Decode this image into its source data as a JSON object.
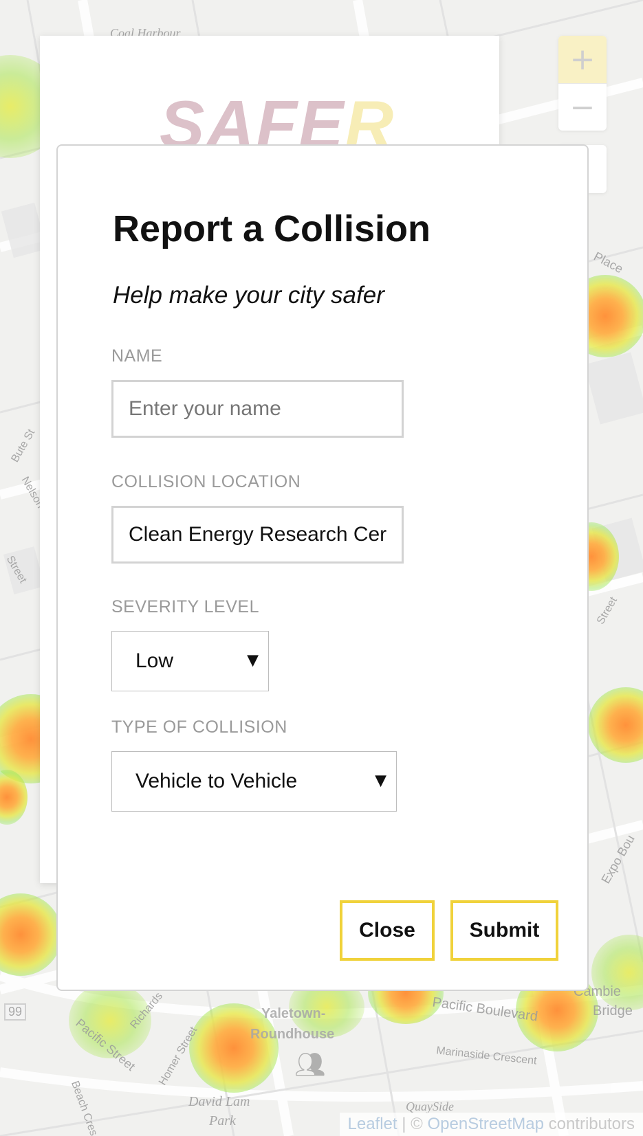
{
  "brand": {
    "logo_part1": "SAFE",
    "logo_part2": "R"
  },
  "map": {
    "zoom_in": "+",
    "zoom_out": "−",
    "labels": {
      "coal_harbour": "Coal Harbour",
      "place": "Place",
      "route_99": "99",
      "pacific_street": "Pacific Street",
      "richards": "Richards",
      "homer_street": "Homer Street",
      "beach_cres": "Beach Cres",
      "yaletown_roundhouse_line1": "Yaletown-",
      "yaletown_roundhouse_line2": "Roundhouse",
      "pacific_boulevard": "Pacific Boulevard",
      "marinaside_crescent": "Marinaside Crescent",
      "quayside": "QuaySide",
      "david_lam_park_line1": "David Lam",
      "david_lam_park_line2": "Park",
      "cambie_bridge_line1": "Cambie",
      "cambie_bridge_line2": "Bridge",
      "expo_boulevard": "Expo Bou",
      "nelson": "Nelson",
      "bute_street": "Bute St",
      "street": "Street",
      "street2": "Street"
    },
    "attribution": {
      "leaflet": "Leaflet",
      "separator": " | © ",
      "osm": "OpenStreetMap",
      "contributors": " contributors"
    }
  },
  "modal": {
    "title": "Report a Collision",
    "subtitle": "Help make your city safer",
    "name": {
      "label": "NAME",
      "placeholder": "Enter your name",
      "value": ""
    },
    "location": {
      "label": "COLLISION LOCATION",
      "value": "Clean Energy Research Cer"
    },
    "severity": {
      "label": "SEVERITY LEVEL",
      "selected": "Low"
    },
    "collision_type": {
      "label": "TYPE OF COLLISION",
      "selected": "Vehicle to Vehicle"
    },
    "close_label": "Close",
    "submit_label": "Submit"
  },
  "colors": {
    "button_border": "#f0d23b",
    "logo_pink": "#dcc1c9",
    "logo_yellow": "#f7edb6",
    "heat_orange": "#ff8c32",
    "heat_green": "#96e650"
  }
}
